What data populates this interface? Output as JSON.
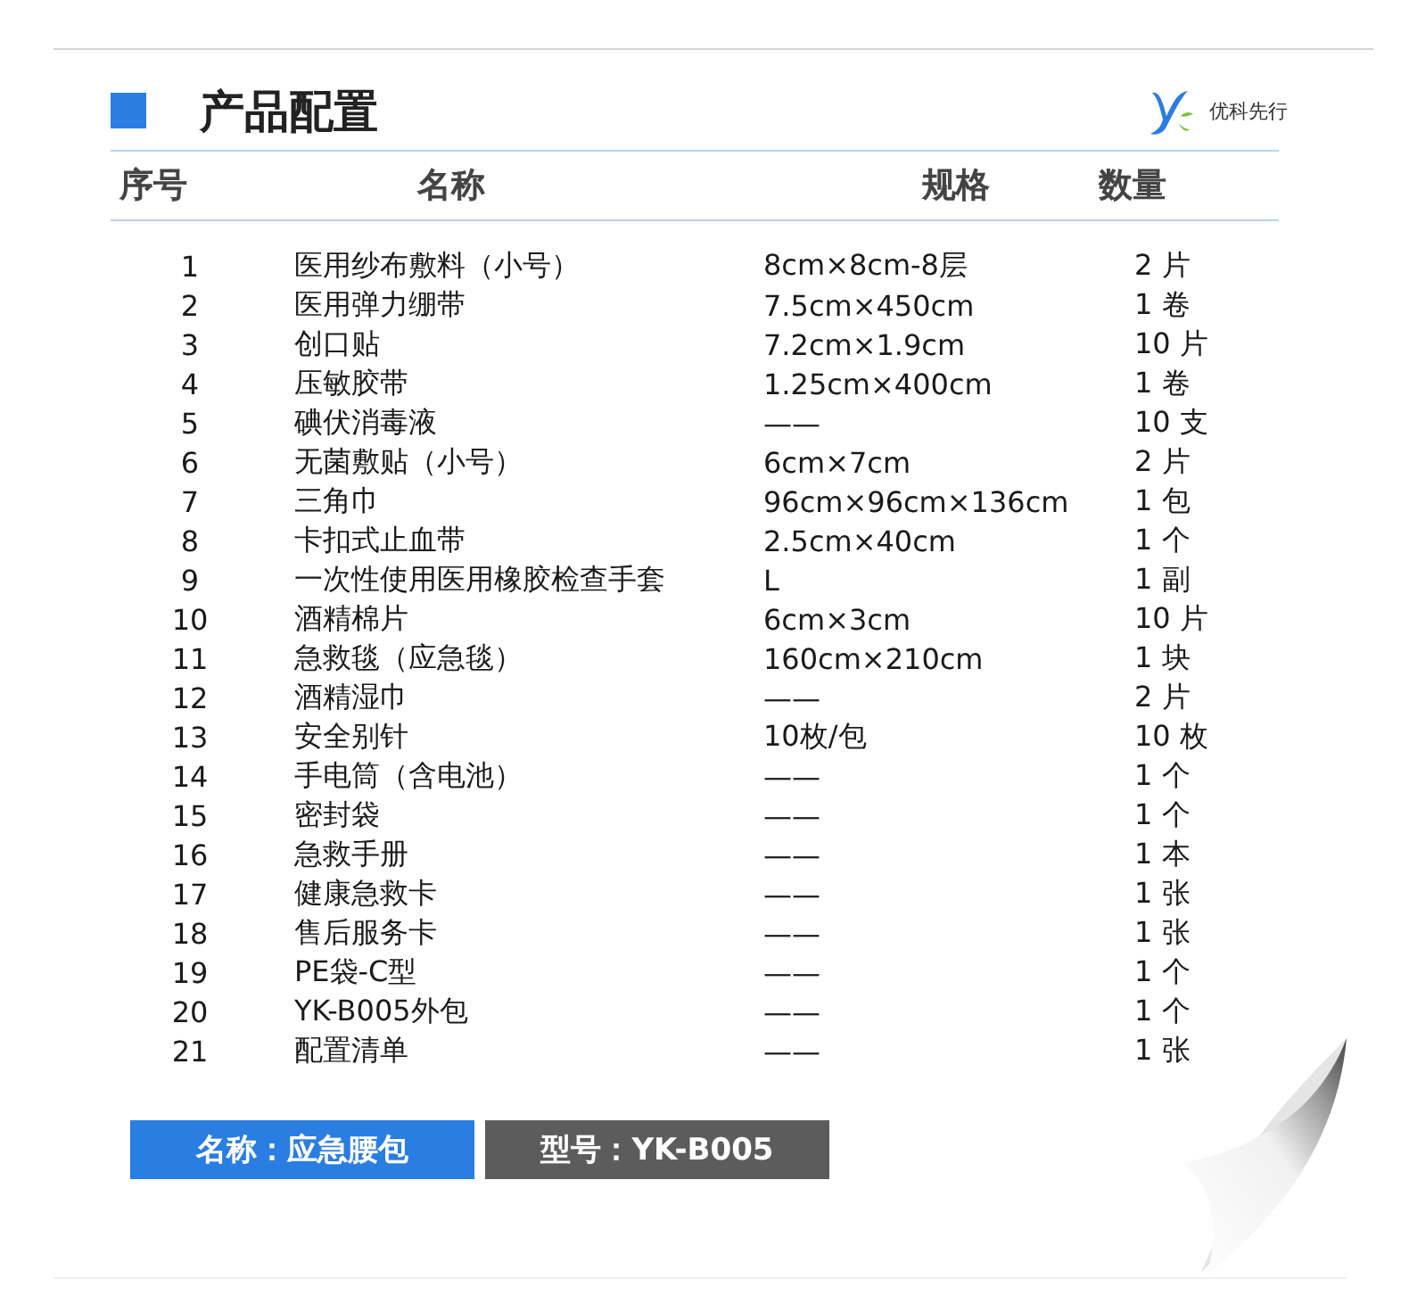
{
  "header": {
    "title": "产品配置",
    "brand": "优科先行"
  },
  "table": {
    "columns": [
      "序号",
      "名称",
      "规格",
      "数量"
    ],
    "rows": [
      [
        "1",
        "医用纱布敷料（小号）",
        "8cm×8cm-8层",
        "2 片"
      ],
      [
        "2",
        "医用弹力绷带",
        "7.5cm×450cm",
        "1 卷"
      ],
      [
        "3",
        "创口贴",
        "7.2cm×1.9cm",
        "10 片"
      ],
      [
        "4",
        "压敏胶带",
        "1.25cm×400cm",
        "1 卷"
      ],
      [
        "5",
        "碘伏消毒液",
        "——",
        "10 支"
      ],
      [
        "6",
        "无菌敷贴（小号）",
        "6cm×7cm",
        "2 片"
      ],
      [
        "7",
        "三角巾",
        "96cm×96cm×136cm",
        "1 包"
      ],
      [
        "8",
        "卡扣式止血带",
        "2.5cm×40cm",
        "1 个"
      ],
      [
        "9",
        "一次性使用医用橡胶检查手套",
        "L",
        "1 副"
      ],
      [
        "10",
        "酒精棉片",
        "6cm×3cm",
        "10 片"
      ],
      [
        "11",
        "急救毯（应急毯）",
        "160cm×210cm",
        "1 块"
      ],
      [
        "12",
        "酒精湿巾",
        "——",
        "2 片"
      ],
      [
        "13",
        "安全别针",
        "10枚/包",
        "10 枚"
      ],
      [
        "14",
        "手电筒（含电池）",
        "——",
        "1 个"
      ],
      [
        "15",
        "密封袋",
        "——",
        "1 个"
      ],
      [
        "16",
        "急救手册",
        "——",
        "1 本"
      ],
      [
        "17",
        "健康急救卡",
        "——",
        "1 张"
      ],
      [
        "18",
        "售后服务卡",
        "——",
        "1 张"
      ],
      [
        "19",
        "PE袋-C型",
        "——",
        "1 个"
      ],
      [
        "20",
        "YK-B005外包",
        "——",
        "1 个"
      ],
      [
        "21",
        "配置清单",
        "——",
        "1 张"
      ]
    ]
  },
  "tags": [
    {
      "kind": "name",
      "text": "名称：应急腰包"
    },
    {
      "kind": "model",
      "text": "型号：YK-B005"
    }
  ]
}
